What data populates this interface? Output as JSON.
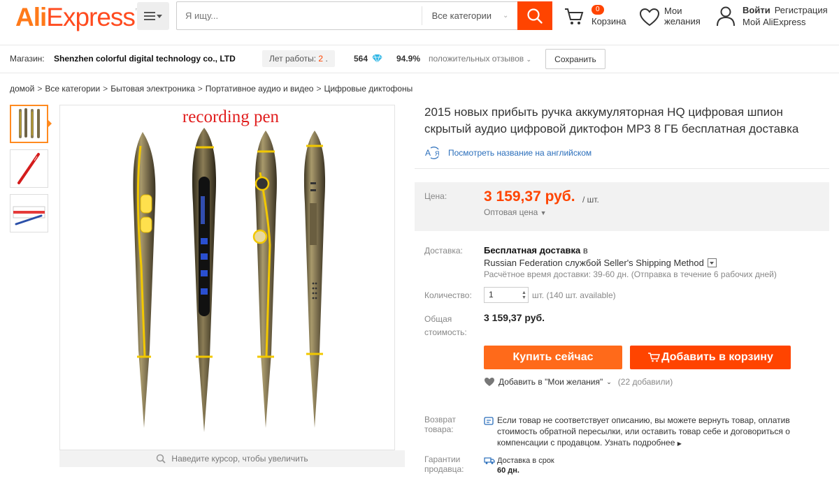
{
  "header": {
    "logo_part1": "Ali",
    "logo_part2": "Express",
    "logo_tm": "™",
    "search_placeholder": "Я ищу...",
    "category": "Все категории",
    "cart_count": "0",
    "cart_label": "Корзина",
    "wishlist_label": "Мои желания",
    "login": "Войти",
    "register": "Регистрация",
    "my_account": "Мой AliExpress"
  },
  "store": {
    "label": "Магазин:",
    "name": "Shenzhen colorful digital technology co., LTD",
    "years_label": "Лет работы:",
    "years_value": "2",
    "years_suffix": ".",
    "score": "564",
    "feedback_pct": "94.9%",
    "feedback_text": "положительных отзывов",
    "save": "Сохранить"
  },
  "breadcrumb": [
    "домой",
    "Все категории",
    "Бытовая электроника",
    "Портативное аудио и видео",
    "Цифровые диктофоны"
  ],
  "gallery": {
    "thumbs": [
      "pens-gold",
      "pen-red",
      "pen-box"
    ],
    "image_caption": "recording pen",
    "zoom_hint": "Наведите курсор, чтобы увеличить"
  },
  "product": {
    "title": "2015 новых прибыть ручка аккумуляторная HQ цифровая шпион скрытый аудио цифровой диктофон MP3 8 ГБ бесплатная доставка",
    "translate_link": "Посмотреть название на английском",
    "price_label": "Цена:",
    "price": "3 159,37 руб.",
    "price_unit": "/ шт.",
    "wholesale": "Оптовая цена",
    "shipping_label": "Доставка:",
    "shipping_title": "Бесплатная доставка",
    "shipping_in": "в",
    "shipping_method": "Russian Federation службой Seller's Shipping Method",
    "shipping_time": "Расчётное время доставки: 39-60 дн. (Отправка в течение 6 рабочих дней)",
    "qty_label": "Количество:",
    "qty_value": "1",
    "qty_note": "шт. (140 шт. available)",
    "total_label": "Общая стоимость:",
    "total": "3 159,37 руб.",
    "buy_now": "Купить сейчас",
    "add_to_cart": "Добавить в корзину",
    "wishlist_add": "Добавить в \"Мои желания\"",
    "wishlist_count": "(22 добавили)",
    "return_label": "Возврат товара:",
    "return_text": "Если товар не соответствует описанию, вы можете вернуть товар, оплатив стоимость обратной пересылки, или оставить товар себе и договориться о компенсации с продавцом.",
    "return_more": "Узнать подробнее",
    "guarantee_label": "Гарантии продавца:",
    "guarantee_text": "Доставка в срок",
    "guarantee_days": "60 дн."
  },
  "colors": {
    "accent": "#ff4400",
    "buy": "#ff6a1a",
    "link": "#2a6ebb",
    "pen_body": "#8a7c55",
    "pen_stripe": "#f2c800"
  }
}
